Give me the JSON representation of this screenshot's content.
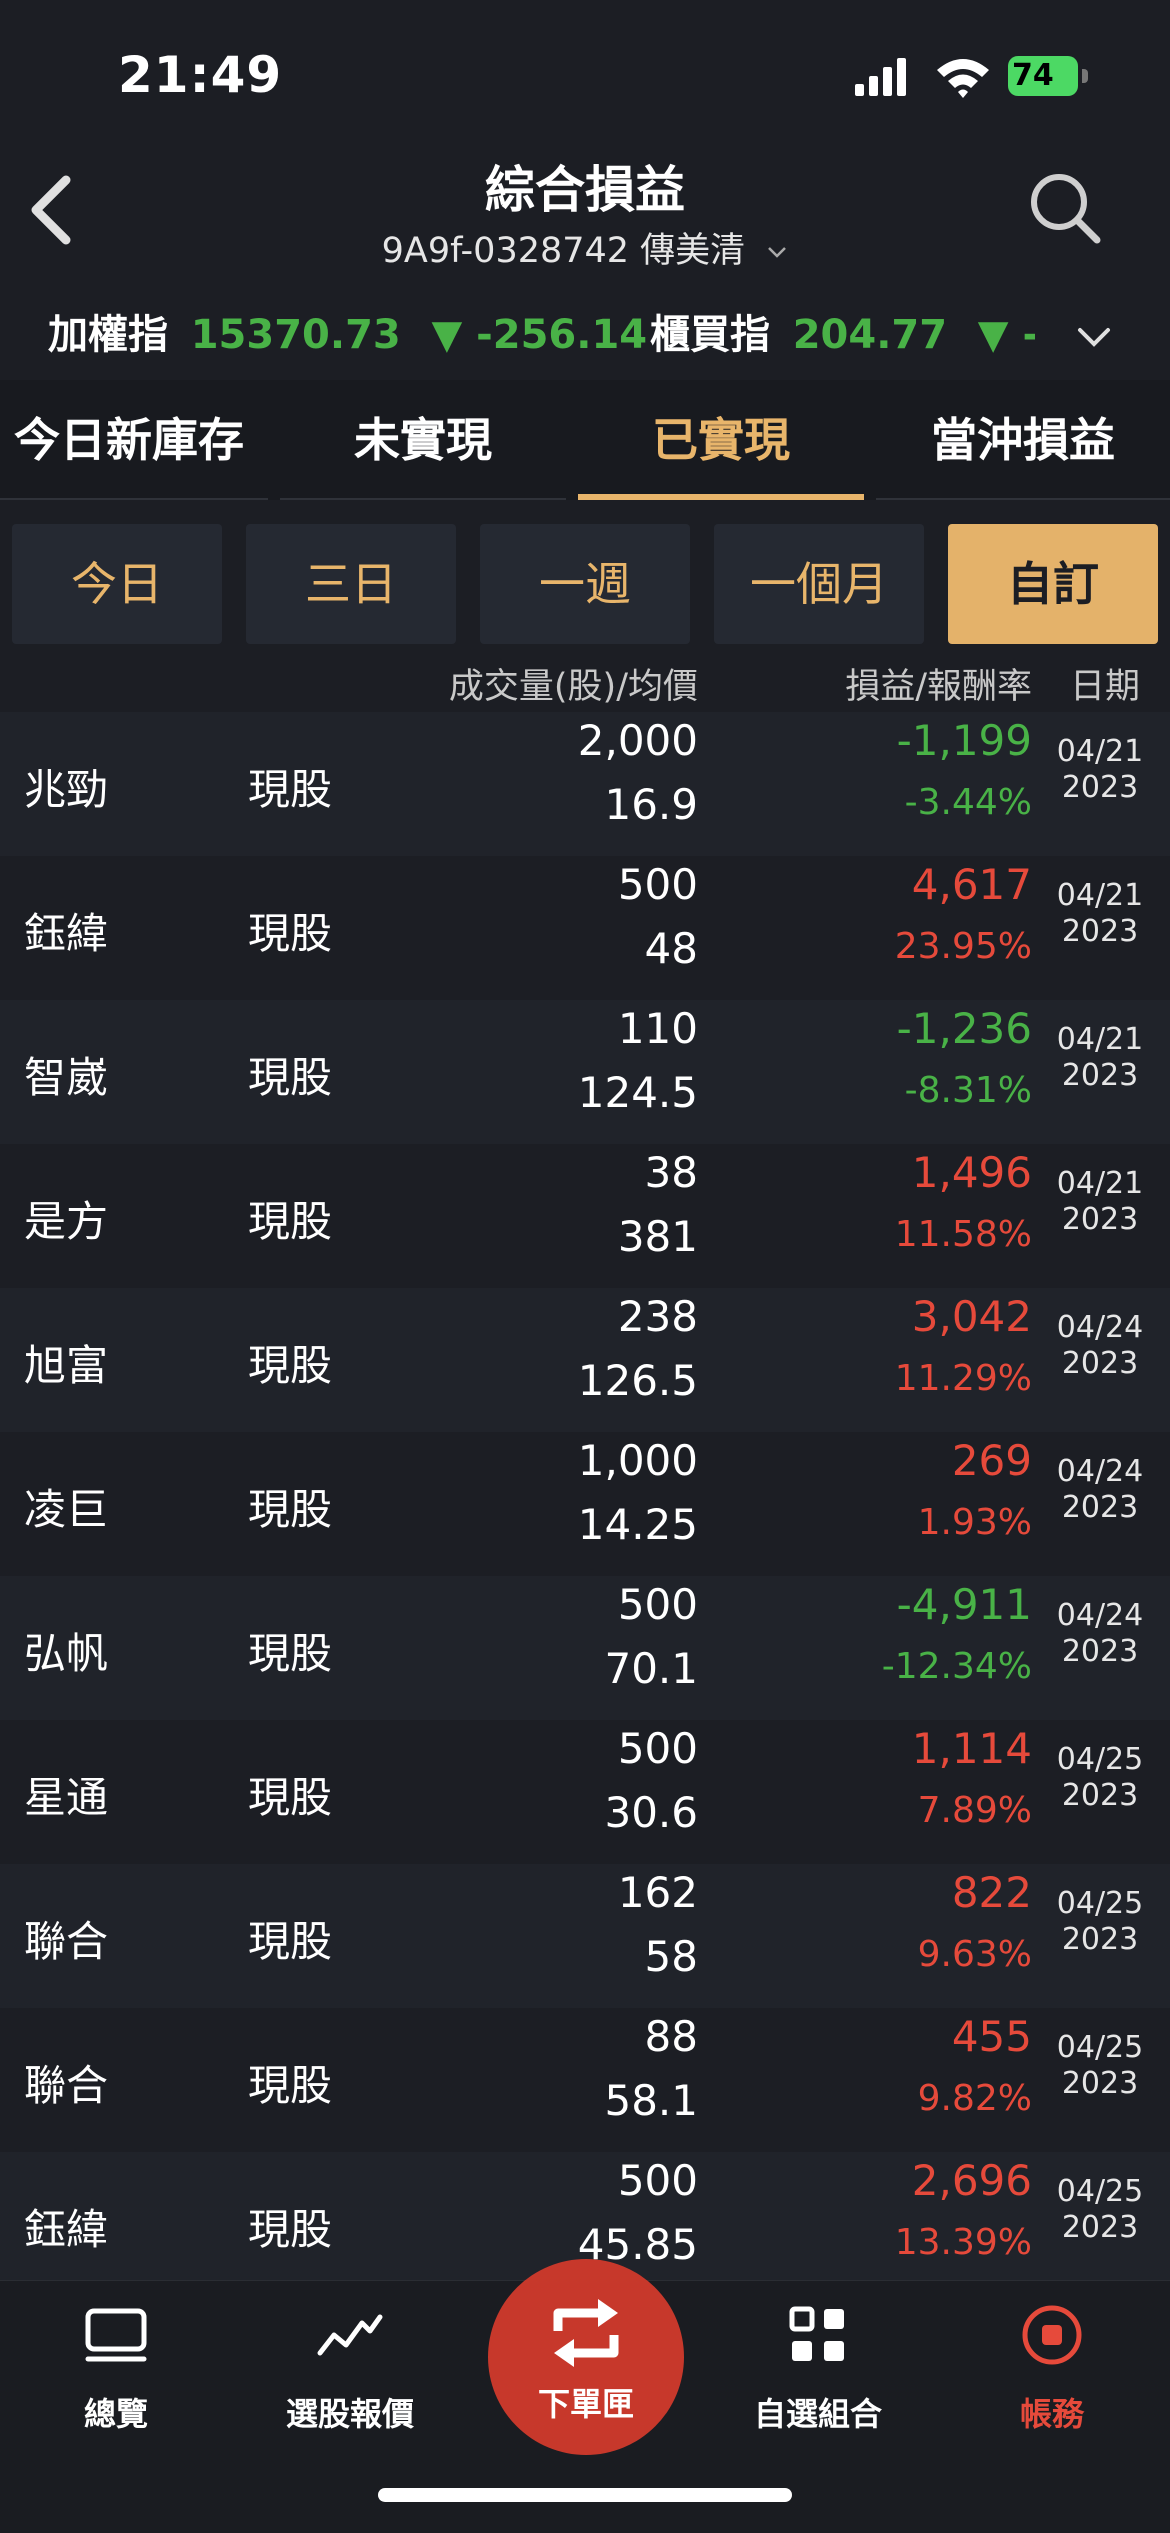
{
  "status": {
    "time": "21:49",
    "battery": "74"
  },
  "header": {
    "title": "綜合損益",
    "account": "9A9f-0328742 傳美清"
  },
  "ticker": [
    {
      "label": "加權指",
      "value": "15370.73",
      "change": "▼ -256.14"
    },
    {
      "label": "櫃買指",
      "value": "204.77",
      "change": "▼ -!"
    }
  ],
  "tabs": [
    "今日新庫存",
    "未實現",
    "已實現",
    "當沖損益"
  ],
  "active_tab": "已實現",
  "filters": [
    "今日",
    "三日",
    "一週",
    "一個月",
    "自訂"
  ],
  "active_filter": "自訂",
  "columns": {
    "volume": "成交量(股)/均價",
    "pnl": "損益/報酬率",
    "date": "日期"
  },
  "colors": {
    "positive": "#e64a3b",
    "negative": "#49b247",
    "accent": "#e8b56b"
  },
  "rows": [
    {
      "name": "兆勁",
      "type": "現股",
      "volume": "2,000",
      "avg": "16.9",
      "pnl": "-1,199",
      "pct": "-3.44%",
      "sign": "neg",
      "date": "04/21",
      "year": "2023"
    },
    {
      "name": "鈺緯",
      "type": "現股",
      "volume": "500",
      "avg": "48",
      "pnl": "4,617",
      "pct": "23.95%",
      "sign": "pos",
      "date": "04/21",
      "year": "2023"
    },
    {
      "name": "智崴",
      "type": "現股",
      "volume": "110",
      "avg": "124.5",
      "pnl": "-1,236",
      "pct": "-8.31%",
      "sign": "neg",
      "date": "04/21",
      "year": "2023"
    },
    {
      "name": "是方",
      "type": "現股",
      "volume": "38",
      "avg": "381",
      "pnl": "1,496",
      "pct": "11.58%",
      "sign": "pos",
      "date": "04/21",
      "year": "2023"
    },
    {
      "name": "旭富",
      "type": "現股",
      "volume": "238",
      "avg": "126.5",
      "pnl": "3,042",
      "pct": "11.29%",
      "sign": "pos",
      "date": "04/24",
      "year": "2023"
    },
    {
      "name": "凌巨",
      "type": "現股",
      "volume": "1,000",
      "avg": "14.25",
      "pnl": "269",
      "pct": "1.93%",
      "sign": "pos",
      "date": "04/24",
      "year": "2023"
    },
    {
      "name": "弘帆",
      "type": "現股",
      "volume": "500",
      "avg": "70.1",
      "pnl": "-4,911",
      "pct": "-12.34%",
      "sign": "neg",
      "date": "04/24",
      "year": "2023"
    },
    {
      "name": "星通",
      "type": "現股",
      "volume": "500",
      "avg": "30.6",
      "pnl": "1,114",
      "pct": "7.89%",
      "sign": "pos",
      "date": "04/25",
      "year": "2023"
    },
    {
      "name": "聯合",
      "type": "現股",
      "volume": "162",
      "avg": "58",
      "pnl": "822",
      "pct": "9.63%",
      "sign": "pos",
      "date": "04/25",
      "year": "2023"
    },
    {
      "name": "聯合",
      "type": "現股",
      "volume": "88",
      "avg": "58.1",
      "pnl": "455",
      "pct": "9.82%",
      "sign": "pos",
      "date": "04/25",
      "year": "2023"
    },
    {
      "name": "鈺緯",
      "type": "現股",
      "volume": "500",
      "avg": "45.85",
      "pnl": "2,696",
      "pct": "13.39%",
      "sign": "pos",
      "date": "04/25",
      "year": "2023"
    }
  ],
  "nav": [
    {
      "label": "總覽",
      "icon": "monitor-icon"
    },
    {
      "label": "選股報價",
      "icon": "trend-icon"
    },
    {
      "label": "下單匣",
      "icon": "repeat-icon"
    },
    {
      "label": "自選組合",
      "icon": "grid-icon"
    },
    {
      "label": "帳務",
      "icon": "record-icon"
    }
  ]
}
